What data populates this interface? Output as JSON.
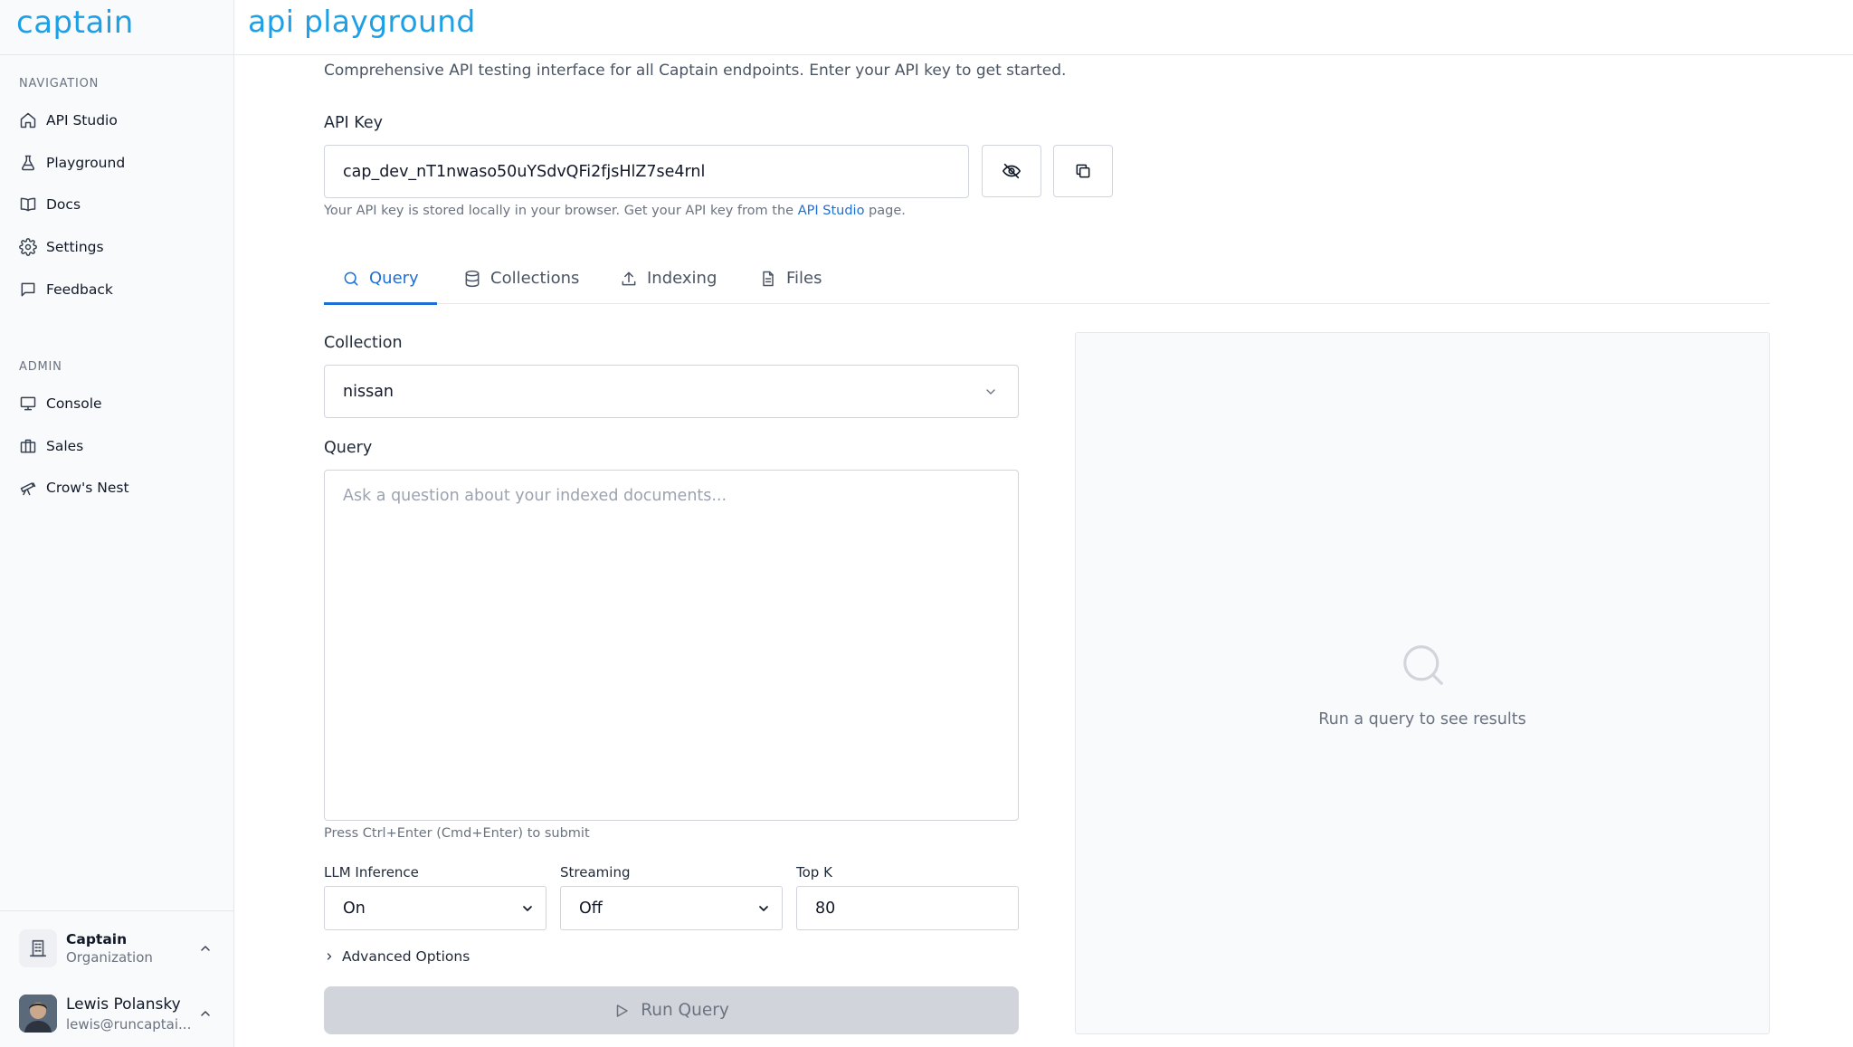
{
  "brand": "captain",
  "page_title": "api playground",
  "nav": {
    "section_label": "NAVIGATION",
    "items": [
      {
        "label": "API Studio",
        "icon": "home-icon"
      },
      {
        "label": "Playground",
        "icon": "flask-icon"
      },
      {
        "label": "Docs",
        "icon": "book-icon"
      },
      {
        "label": "Settings",
        "icon": "gear-icon"
      },
      {
        "label": "Feedback",
        "icon": "message-icon"
      }
    ]
  },
  "admin": {
    "section_label": "ADMIN",
    "items": [
      {
        "label": "Console",
        "icon": "monitor-icon"
      },
      {
        "label": "Sales",
        "icon": "briefcase-icon"
      },
      {
        "label": "Crow's Nest",
        "icon": "telescope-icon"
      }
    ]
  },
  "org": {
    "name": "Captain",
    "sub": "Organization"
  },
  "user": {
    "name": "Lewis Polansky",
    "email": "lewis@runcaptai..."
  },
  "intro": "Comprehensive API testing interface for all Captain endpoints. Enter your API key to get started.",
  "api_key": {
    "label": "API Key",
    "value": "cap_dev_nT1nwaso50uYSdvQFi2fjsHlZ7se4rnl",
    "hint_before": "Your API key is stored locally in your browser. Get your API key from the ",
    "hint_link": "API Studio",
    "hint_after": " page."
  },
  "tabs": [
    {
      "label": "Query",
      "icon": "search-icon",
      "active": true
    },
    {
      "label": "Collections",
      "icon": "database-icon",
      "active": false
    },
    {
      "label": "Indexing",
      "icon": "upload-icon",
      "active": false
    },
    {
      "label": "Files",
      "icon": "file-icon",
      "active": false
    }
  ],
  "query_form": {
    "collection_label": "Collection",
    "collection_value": "nissan",
    "query_label": "Query",
    "query_placeholder": "Ask a question about your indexed documents...",
    "submit_hint": "Press Ctrl+Enter (Cmd+Enter) to submit",
    "llm_label": "LLM Inference",
    "llm_value": "On",
    "streaming_label": "Streaming",
    "streaming_value": "Off",
    "topk_label": "Top K",
    "topk_value": "80",
    "advanced_label": "Advanced Options",
    "run_label": "Run Query"
  },
  "results": {
    "empty_text": "Run a query to see results"
  },
  "colors": {
    "accent": "#1ea0e6",
    "link": "#1d6fd6"
  }
}
